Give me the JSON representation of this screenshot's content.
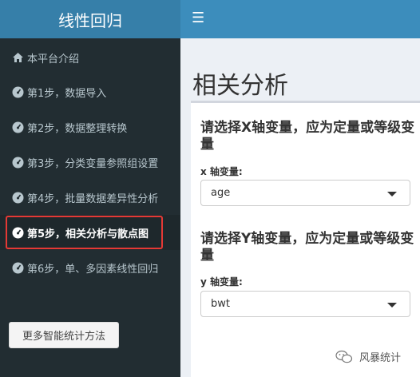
{
  "header": {
    "app_title": "线性回归",
    "menu_toggle_icon": "bars-icon"
  },
  "sidebar": {
    "items": [
      {
        "label": "本平台介绍",
        "icon": "home-icon"
      },
      {
        "label": "第1步，数据导入",
        "icon": "dashboard-icon"
      },
      {
        "label": "第2步，数据整理转换",
        "icon": "dashboard-icon"
      },
      {
        "label": "第3步，分类变量参照组设置",
        "icon": "dashboard-icon"
      },
      {
        "label": "第4步，批量数据差异性分析",
        "icon": "dashboard-icon"
      },
      {
        "label": "第5步，相关分析与散点图",
        "icon": "dashboard-icon",
        "active": true
      },
      {
        "label": "第6步，单、多因素线性回归",
        "icon": "dashboard-icon"
      }
    ],
    "more_button": "更多智能统计方法"
  },
  "main": {
    "page_title": "相关分析",
    "x_section": {
      "title": "请选择X轴变量，应为定量或等级变量",
      "label": "x 轴变量:",
      "value": "age"
    },
    "y_section": {
      "title": "请选择Y轴变量，应为定量或等级变量",
      "label": "y 轴变量:",
      "value": "bwt"
    }
  },
  "watermark": {
    "text": "风暴统计",
    "icon": "wechat-icon"
  },
  "colors": {
    "header": "#3c8dbc",
    "logo": "#367fa9",
    "sidebar": "#222d32",
    "highlight": "#e53935"
  }
}
